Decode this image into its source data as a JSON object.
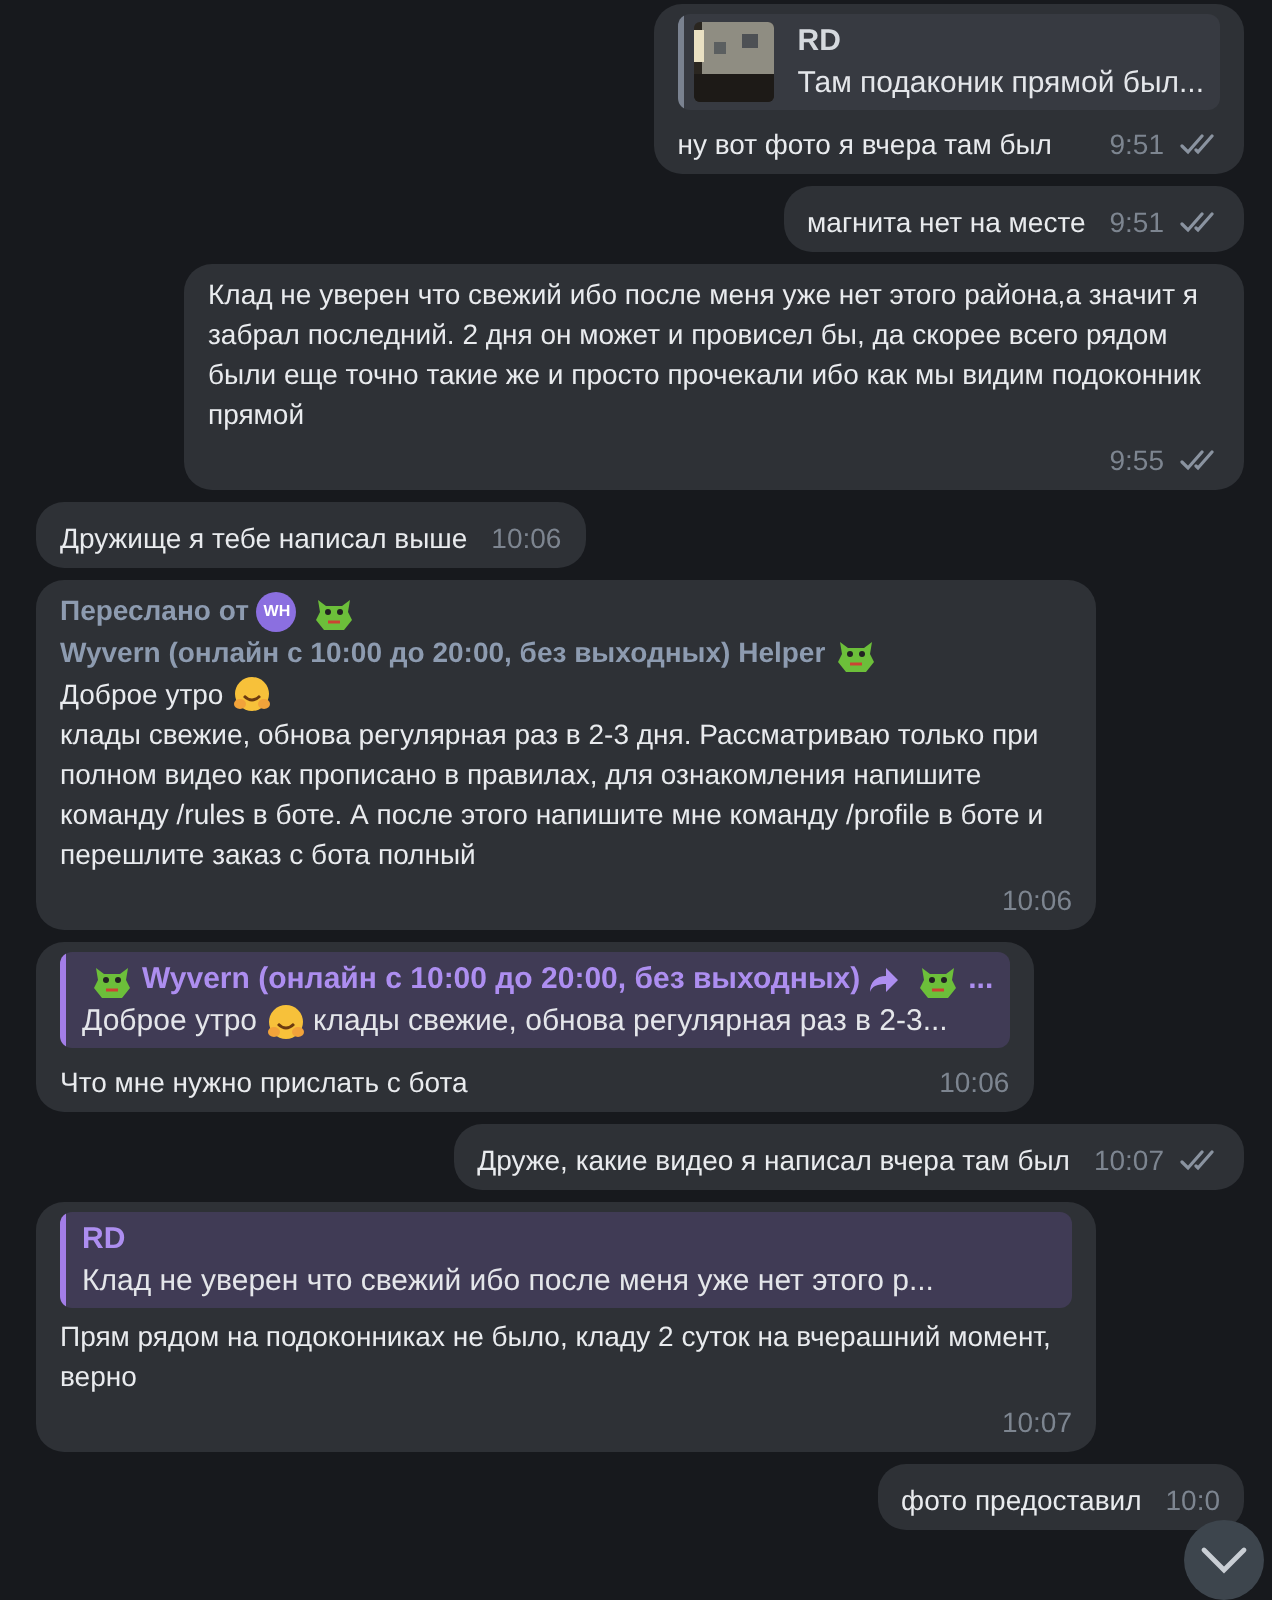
{
  "messages": [
    {
      "kind": "outgoing",
      "reply": {
        "author": "RD",
        "text": "Там подаконик прямой был...",
        "color": "#7a8290",
        "picture": true
      },
      "parts": [
        "ну вот фото я вчера там был"
      ],
      "time": "9:51",
      "read": true
    },
    {
      "kind": "outgoing",
      "parts": [
        "магнита нет на месте"
      ],
      "time": "9:51",
      "read": true
    },
    {
      "kind": "outgoing",
      "parts": [
        "Клад не уверен что свежий ибо после меня уже нет этого района,а значит я забрал последний. 2 дня он может и провисел бы, да скорее всего рядом были еще точно такие же и просто прочекали ибо как мы видим подоконник прямой"
      ],
      "time": "9:55",
      "read": true
    },
    {
      "kind": "incoming",
      "parts": [
        "Дружище я тебе написал выше"
      ],
      "time": "10:06"
    },
    {
      "kind": "incoming",
      "forward": {
        "prefix": "Переслано от",
        "avatar": "WH",
        "name": "Wyvern (онлайн с 10:00 до 20:00, без выходных) Helper"
      },
      "parts": [
        "Доброе утро",
        "клады свежие, обнова регулярная раз в 2-3 дня. Рассматриваю только при полном видео как прописано в правилах, для ознакомления напишите команду /rules в боте. А после этого напишите мне команду /profile в боте и перешлите заказ с бота полный"
      ],
      "time": "10:06"
    },
    {
      "kind": "incoming",
      "reply": {
        "author": "Wyvern (онлайн с 10:00 до 20:00, без выходных)",
        "author_end": "...",
        "text_parts": [
          "Доброе утро",
          "клады свежие, обнова регулярная раз в 2-3..."
        ],
        "color": "#a37ee8"
      },
      "parts": [
        "Что мне нужно прислать с бота"
      ],
      "time": "10:06"
    },
    {
      "kind": "outgoing",
      "parts": [
        "Друже, какие видео я написал вчера там был"
      ],
      "time": "10:07",
      "read": true
    },
    {
      "kind": "incoming",
      "reply": {
        "author": "RD",
        "text": "Клад не уверен что свежий ибо после меня уже нет этого р...",
        "color": "#a37ee8"
      },
      "parts": [
        "Прям рядом на подоконниках не было, кладу 2 суток на вчерашний момент, верно"
      ],
      "time": "10:07"
    },
    {
      "kind": "outgoing",
      "parts": [
        "фото предоставил"
      ],
      "time": "10:0"
    }
  ]
}
